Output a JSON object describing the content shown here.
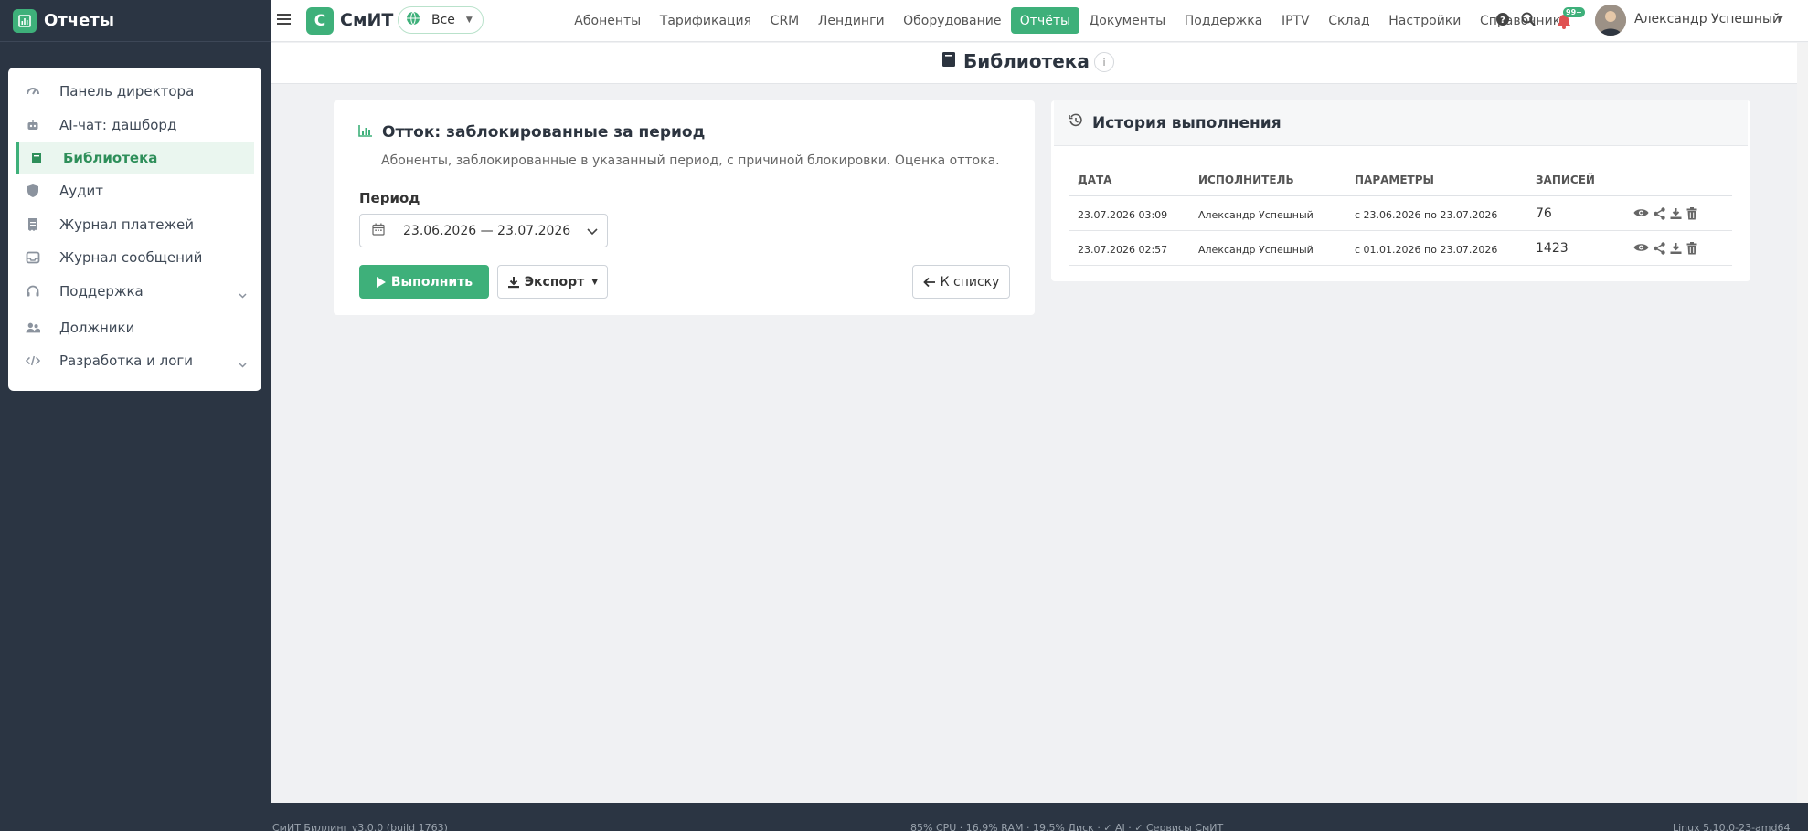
{
  "sidebar": {
    "title": "Отчеты",
    "items": [
      {
        "label": "Панель директора"
      },
      {
        "label": "AI-чат: дашборд"
      },
      {
        "label": "Библиотека"
      },
      {
        "label": "Аудит"
      },
      {
        "label": "Журнал платежей"
      },
      {
        "label": "Журнал сообщений"
      },
      {
        "label": "Поддержка"
      },
      {
        "label": "Должники"
      },
      {
        "label": "Разработка и логи"
      }
    ]
  },
  "topbar": {
    "brand_logo": "С",
    "brand": "СмИТ",
    "scope": "Все",
    "nav": [
      "Абоненты",
      "Тарификация",
      "CRM",
      "Лендинги",
      "Оборудование",
      "Отчёты",
      "Документы",
      "Поддержка",
      "IPTV",
      "Склад",
      "Настройки",
      "Справочники"
    ],
    "notifications": "99+",
    "user": "Александр Успешный"
  },
  "page": {
    "title": "Библиотека",
    "info": "i"
  },
  "report": {
    "title": "Отток: заблокированные за период",
    "description": "Абоненты, заблокированные в указанный период, с причиной блокировки. Оценка оттока.",
    "period_label": "Период",
    "period_value": "23.06.2026 — 23.07.2026",
    "run_label": "Выполнить",
    "export_label": "Экспорт",
    "back_label": "К списку"
  },
  "history": {
    "title": "История выполнения",
    "columns": [
      "ДАТА",
      "ИСПОЛНИТЕЛЬ",
      "ПАРАМЕТРЫ",
      "ЗАПИСЕЙ"
    ],
    "rows": [
      {
        "date": "23.07.2026 03:09",
        "executor": "Александр Успешный",
        "params": "с 23.06.2026 по 23.07.2026",
        "records": "76"
      },
      {
        "date": "23.07.2026 02:57",
        "executor": "Александр Успешный",
        "params": "с 01.01.2026 по 23.07.2026",
        "records": "1423"
      }
    ]
  },
  "footer": {
    "left": "СмИТ Биллинг v3.0.0 (build 1763)",
    "center": "85% CPU · 16.9% RAM · 19.5% Диск · ✓ AI · ✓ Сервисы СмИТ",
    "right": "Linux 5.10.0-23-amd64"
  },
  "colors": {
    "accent": "#3eb07a",
    "sidebar_bg": "#2b3543",
    "page_bg": "#f0f1f3"
  }
}
